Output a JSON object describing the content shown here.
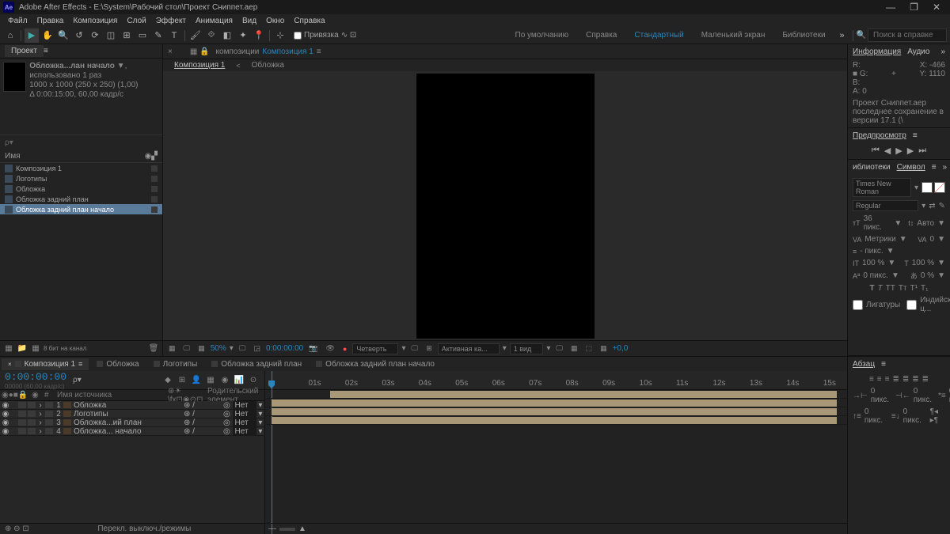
{
  "titlebar": {
    "app_name": "Adobe After Effects",
    "file_path": "E:\\System\\Рабочий стол\\Проект Сниппет.aep",
    "app_icon": "Ae"
  },
  "menubar": [
    "Файл",
    "Правка",
    "Композиция",
    "Слой",
    "Эффект",
    "Анимация",
    "Вид",
    "Окно",
    "Справка"
  ],
  "toolbar": {
    "snapping": "Привязка",
    "workspaces": {
      "default": "По умолчанию",
      "help": "Справка",
      "standard": "Стандартный",
      "small": "Маленький экран",
      "lib": "Библиотеки"
    },
    "search_placeholder": "Поиск в справке"
  },
  "project": {
    "title": "Проект",
    "selected_name": "Обложка...лан начало",
    "used": ", использовано 1 раз",
    "dims": "1000 x 1000  (250 x 250) (1,00)",
    "duration": "Δ 0:00:15:00, 60,00 кадр/с",
    "col_name": "Имя",
    "items": [
      {
        "name": "Композиция 1",
        "type": "comp"
      },
      {
        "name": "Логотипы",
        "type": "comp"
      },
      {
        "name": "Обложка",
        "type": "comp"
      },
      {
        "name": "Обложка задний план",
        "type": "comp"
      },
      {
        "name": "Обложка задний план начало",
        "type": "comp",
        "selected": true
      }
    ],
    "footer_bpc": "8 бит на канал"
  },
  "comp": {
    "crumb_prefix": "композиции",
    "crumb_name": "Композиция 1",
    "subtab_active": "Композиция 1",
    "subtab_other": "Обложка",
    "zoom": "50%",
    "timecode": "0:00:00:00",
    "quality": "Четверть",
    "camera": "Активная ка...",
    "views": "1 вид",
    "exposure": "+0,0"
  },
  "info_panel": {
    "title": "Информация",
    "audio": "Аудио",
    "r": "R:",
    "g": "G:",
    "b": "B:",
    "a": "A:  0",
    "x": "X:  -466",
    "y": "Y:  1110",
    "plus": "+",
    "filename": "Проект Сниппет.aep",
    "saved": "последнее сохранение в версии 17.1 (\\"
  },
  "preview": {
    "title": "Предпросмотр"
  },
  "char_panel": {
    "lib": "иблиотеки",
    "title": "Символ",
    "font": "Times New Roman",
    "weight": "Regular",
    "size": "36 пикс.",
    "leading": "Авто",
    "kerning": "Метрики",
    "tracking": "0",
    "stroke_lbl": "-  пикс.",
    "vscale": "100 %",
    "hscale": "100 %",
    "baseline": "0 пикс.",
    "tsume": "0 %",
    "ligatures": "Лигатуры",
    "hindi": "Индийские ц..."
  },
  "paragraph": {
    "title": "Абзац",
    "indent": "0 пикс."
  },
  "timeline": {
    "tabs": [
      {
        "name": "Композиция 1",
        "active": true
      },
      {
        "name": "Обложка"
      },
      {
        "name": "Логотипы"
      },
      {
        "name": "Обложка задний план"
      },
      {
        "name": "Обложка задний план начало"
      }
    ],
    "timecode": "0:00:00:00",
    "timecode_sub": "00000 (60.00 кадр/с)",
    "col_num": "#",
    "col_name": "Имя источника",
    "col_parent": "Родительский элемент...",
    "mode_none": "Нет",
    "layers": [
      {
        "num": 1,
        "name": "Обложка"
      },
      {
        "num": 2,
        "name": "Логотипы"
      },
      {
        "num": 3,
        "name": "Обложка...ий план"
      },
      {
        "num": 4,
        "name": "Обложка... начало"
      }
    ],
    "ticks": [
      "01s",
      "02s",
      "03s",
      "04s",
      "05s",
      "06s",
      "07s",
      "08s",
      "09s",
      "10s",
      "11s",
      "12s",
      "13s",
      "14s",
      "15s"
    ],
    "footer": "Перекл. выключ./режимы"
  }
}
